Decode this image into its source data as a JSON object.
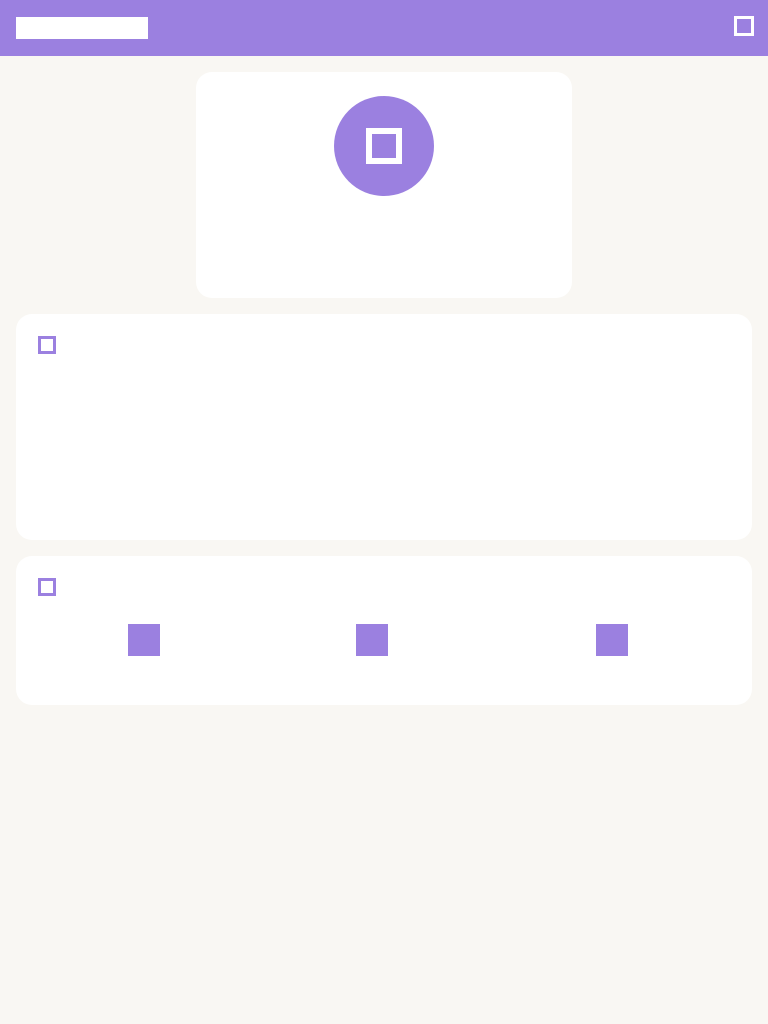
{
  "header": {
    "title": "",
    "icons": {
      "menu": "square-icon"
    }
  },
  "profile": {
    "name": "",
    "subtitle": "",
    "avatar_icon": "square-icon"
  },
  "info_section": {
    "title": "",
    "icon": "square-outline-icon",
    "rows": [
      {
        "label": "",
        "value": ""
      },
      {
        "label": "",
        "value": ""
      },
      {
        "label": "",
        "value": ""
      },
      {
        "label": "",
        "value": ""
      }
    ]
  },
  "actions_section": {
    "title": "",
    "icon": "square-outline-icon",
    "actions": [
      {
        "label": "",
        "icon": "square-icon"
      },
      {
        "label": "",
        "icon": "square-icon"
      },
      {
        "label": "",
        "icon": "square-icon"
      }
    ]
  },
  "colors": {
    "accent": "#9b80e0",
    "background": "#f9f7f3",
    "card": "#ffffff",
    "text": "#1c1c1c",
    "muted": "#8e8e8e"
  }
}
